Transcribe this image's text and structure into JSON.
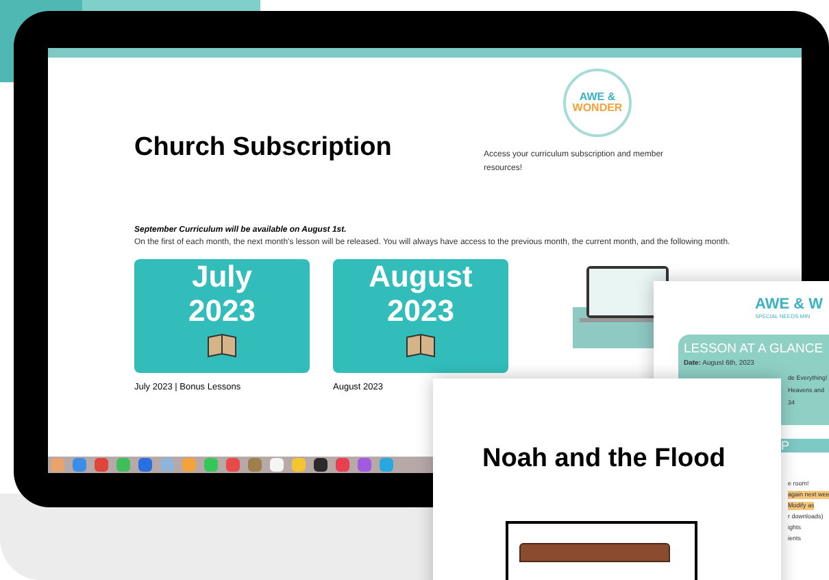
{
  "page": {
    "title": "Church Subscription",
    "logo": {
      "line1": "AWE &",
      "line2": "WONDER"
    },
    "intro": "Access your curriculum subscription and member resources!",
    "notice": {
      "headline": "September Curriculum will be available on August 1st.",
      "body": "On the first of each month, the next month's lesson will be released.  You will always have access to the previous month, the current month, and the following month."
    },
    "cards": [
      {
        "month": "July",
        "year": "2023",
        "caption": "July 2023 | Bonus Lessons"
      },
      {
        "month": "August",
        "year": "2023",
        "caption": "August 2023"
      }
    ]
  },
  "dock": {
    "icons": [
      {
        "color": "#e8a46a"
      },
      {
        "color": "#3b8ee8"
      },
      {
        "color": "#e0453a"
      },
      {
        "color": "#3fbf5a"
      },
      {
        "color": "#2a6fe0"
      },
      {
        "color": "#8fb3d9"
      },
      {
        "color": "#f2a33a"
      },
      {
        "color": "#34c759"
      },
      {
        "color": "#e84a4a"
      },
      {
        "color": "#a0804a"
      },
      {
        "color": "#f4f4f4"
      },
      {
        "color": "#f5c531"
      },
      {
        "color": "#2b2b2b"
      },
      {
        "color": "#e8404f"
      },
      {
        "color": "#a15ae0"
      },
      {
        "color": "#29a8e0"
      }
    ]
  },
  "lesson_sheet": {
    "brand": "AWE & W",
    "subtitle": "SPECIAL NEEDS MIN",
    "banner": "LESSON AT A GLANCE",
    "date_label": "Date:",
    "date": "August 6th, 2023",
    "lines": [
      "de Everything!",
      "Heavens and",
      "34"
    ],
    "section": "P",
    "notes": [
      {
        "text": "e room!",
        "highlight": false
      },
      {
        "text": "again next wee",
        "highlight": true
      },
      {
        "text": "Modify as",
        "highlight": true
      },
      {
        "text": "r downloads)",
        "highlight": false
      },
      {
        "text": "ights",
        "highlight": false
      },
      {
        "text": "ients",
        "highlight": false
      }
    ]
  },
  "story_page": {
    "title": "Noah and the Flood"
  }
}
